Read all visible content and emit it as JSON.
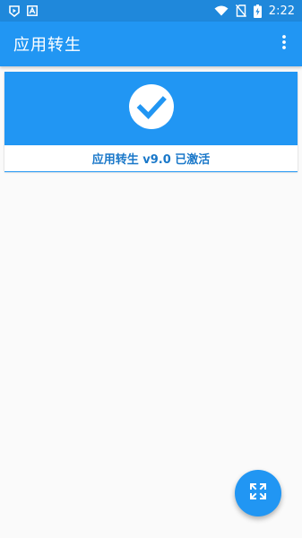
{
  "status_bar": {
    "time": "2:22",
    "left_icons": [
      "play-protect-icon",
      "notification-a-icon"
    ],
    "right_icons": [
      "wifi-icon",
      "no-sim-icon",
      "battery-charging-icon"
    ]
  },
  "app_bar": {
    "title": "应用转生",
    "overflow_icon": "more-vert-icon"
  },
  "status_card": {
    "icon": "check-circle-icon",
    "text": "应用转生 v9.0 已激活"
  },
  "fab": {
    "icon": "fullscreen-expand-icon"
  },
  "colors": {
    "primary": "#2196f3",
    "status_bar": "#1f88db",
    "card_text": "#1a78c9",
    "background": "#fafafa"
  }
}
